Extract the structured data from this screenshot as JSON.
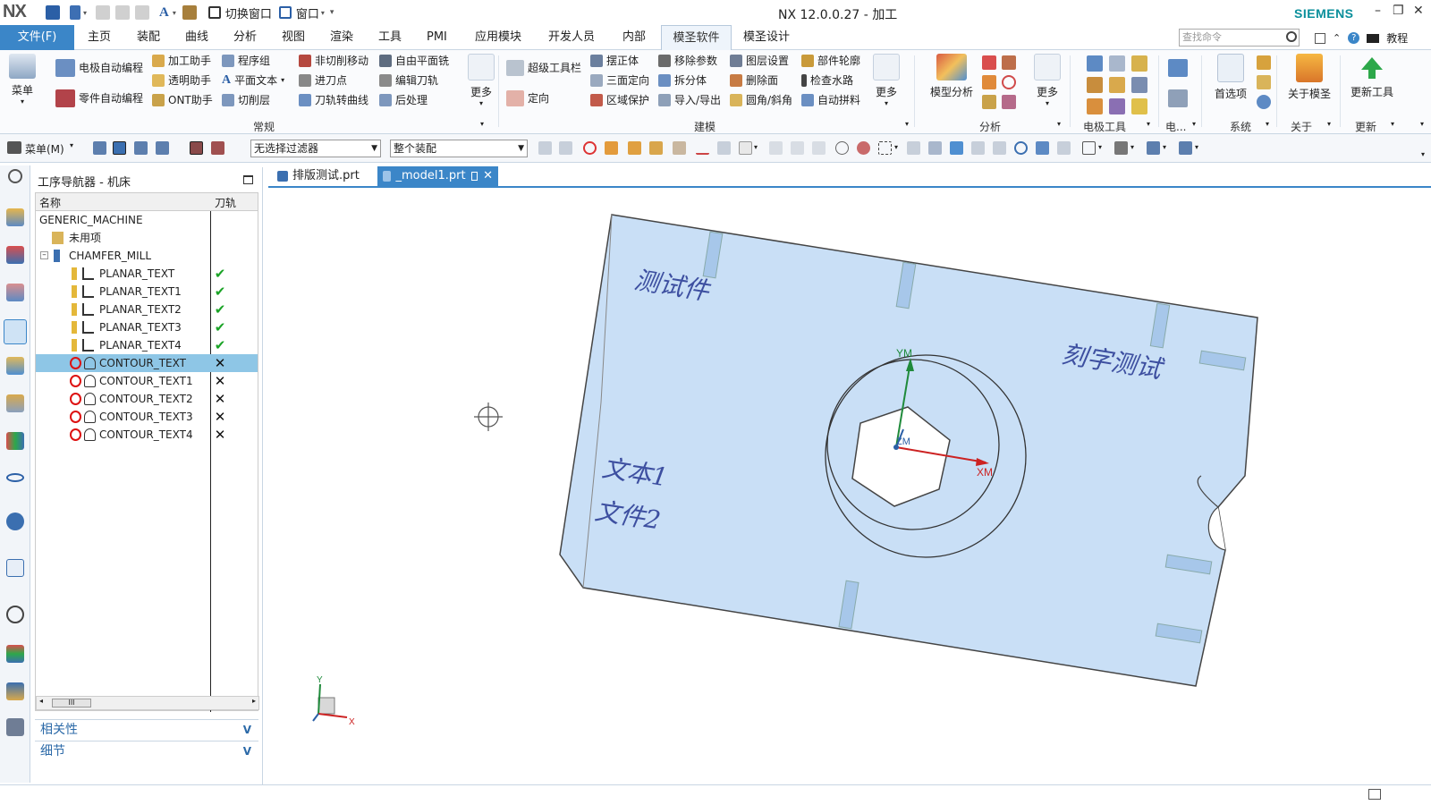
{
  "app": {
    "logo": "NX",
    "title": "NX 12.0.0.27 - 加工",
    "brand": "SIEMENS",
    "quick_access": {
      "switch_window": "切换窗口",
      "window": "窗口"
    }
  },
  "menubar": {
    "file": "文件(F)",
    "tabs": [
      "主页",
      "装配",
      "曲线",
      "分析",
      "视图",
      "渲染",
      "工具",
      "PMI",
      "应用模块",
      "开发人员",
      "内部",
      "模圣软件",
      "模圣设计"
    ],
    "active_tab": "模圣软件",
    "search_placeholder": "查找命令",
    "tutorial": "教程"
  },
  "ribbon": {
    "menu_label": "菜单",
    "common": {
      "col1": [
        "电极自动编程",
        "零件自动编程"
      ],
      "col2": [
        "加工助手",
        "透明助手",
        "ONT助手"
      ],
      "col3": [
        "程序组",
        "平面文本",
        "切削层"
      ],
      "col4": [
        "非切削移动",
        "进刀点",
        "刀轨转曲线"
      ],
      "col5": [
        "自由平面铣",
        "编辑刀轨",
        "后处理"
      ],
      "more": "更多",
      "group": "常规"
    },
    "modeling": {
      "col1": [
        "超级工具栏",
        "定向"
      ],
      "col2": [
        "摆正体",
        "三面定向",
        "区域保护"
      ],
      "col3": [
        "移除参数",
        "拆分体",
        "导入/导出"
      ],
      "col4": [
        "图层设置",
        "删除面",
        "圆角/斜角"
      ],
      "col5": [
        "部件轮廓",
        "检查水路",
        "自动拼料"
      ],
      "more": "更多",
      "group": "建模"
    },
    "analysis": {
      "big": "模型分析",
      "more": "更多",
      "group": "分析"
    },
    "electrode": {
      "group": "电极工具",
      "group2": "电..."
    },
    "system": {
      "big": "首选项",
      "group": "系统"
    },
    "about": {
      "big": "关于模圣",
      "group": "关于"
    },
    "update": {
      "big": "更新工具",
      "group": "更新"
    }
  },
  "toolbar": {
    "menu": "菜单(M)",
    "filter": "无选择过滤器",
    "scope": "整个装配"
  },
  "navigator": {
    "title": "工序导航器 - 机床",
    "col_name": "名称",
    "col_toolpath": "刀轨",
    "rows": [
      {
        "name": "GENERIC_MACHINE",
        "status": ""
      },
      {
        "name": "未用项",
        "status": ""
      },
      {
        "name": "CHAMFER_MILL",
        "status": ""
      },
      {
        "name": "PLANAR_TEXT",
        "status": "✔"
      },
      {
        "name": "PLANAR_TEXT1",
        "status": "✔"
      },
      {
        "name": "PLANAR_TEXT2",
        "status": "✔"
      },
      {
        "name": "PLANAR_TEXT3",
        "status": "✔"
      },
      {
        "name": "PLANAR_TEXT4",
        "status": "✔"
      },
      {
        "name": "CONTOUR_TEXT",
        "status": "✕"
      },
      {
        "name": "CONTOUR_TEXT1",
        "status": "✕"
      },
      {
        "name": "CONTOUR_TEXT2",
        "status": "✕"
      },
      {
        "name": "CONTOUR_TEXT3",
        "status": "✕"
      },
      {
        "name": "CONTOUR_TEXT4",
        "status": "✕"
      }
    ],
    "selected": "CONTOUR_TEXT",
    "scroll_thumb": "III",
    "panel_dependencies": "相关性",
    "panel_details": "细节"
  },
  "documents": {
    "tabs": [
      "排版测试.prt",
      "_model1.prt"
    ],
    "active": "_model1.prt"
  },
  "model": {
    "text1": "测试件",
    "text2": "刻字测试",
    "text3": "文本1",
    "text4": "文件2",
    "axis_ym": "YM",
    "axis_xm": "XM",
    "axis_zm": "ZM",
    "triad_y": "Y",
    "triad_x": "X"
  },
  "colors": {
    "accent": "#3b86c8",
    "brand": "#0a8f9b",
    "part_fill": "#c9dff6",
    "check": "#1aa326"
  }
}
